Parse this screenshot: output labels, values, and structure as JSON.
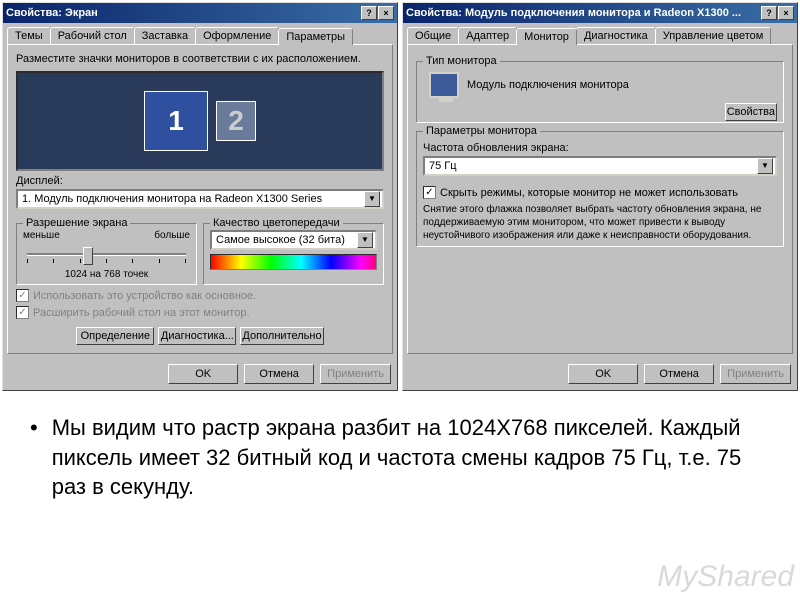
{
  "left": {
    "title": "Свойства: Экран",
    "tabs": [
      "Темы",
      "Рабочий стол",
      "Заставка",
      "Оформление",
      "Параметры"
    ],
    "active_tab": 4,
    "instruction": "Разместите значки мониторов в соответствии с их расположением.",
    "monitors": {
      "primary": "1",
      "secondary": "2"
    },
    "display_label": "Дисплей:",
    "display_value": "1. Модуль подключения монитора на Radeon X1300 Series",
    "resolution": {
      "title": "Разрешение экрана",
      "less": "меньше",
      "more": "больше",
      "value": "1024 на 768 точек"
    },
    "quality": {
      "title": "Качество цветопередачи",
      "value": "Самое высокое (32 бита)"
    },
    "check_primary": "Использовать это устройство как основное.",
    "check_extend": "Расширить рабочий стол на этот монитор.",
    "buttons": {
      "identify": "Определение",
      "troubleshoot": "Диагностика...",
      "advanced": "Дополнительно"
    }
  },
  "right": {
    "title": "Свойства: Модуль подключения монитора и Radeon X1300 ...",
    "tabs": [
      "Общие",
      "Адаптер",
      "Монитор",
      "Диагностика",
      "Управление цветом"
    ],
    "active_tab": 2,
    "group_type": "Тип монитора",
    "monitor_name": "Модуль подключения монитора",
    "properties_btn": "Свойства",
    "group_params": "Параметры монитора",
    "refresh_label": "Частота обновления экрана:",
    "refresh_value": "75 Гц",
    "hide_modes": "Скрыть режимы, которые монитор не может использовать",
    "hide_modes_info": "Снятие этого флажка позволяет выбрать частоту обновления экрана, не поддерживаемую этим монитором, что может привести к выводу неустойчивого изображения или даже к неисправности оборудования."
  },
  "dialog": {
    "ok": "OK",
    "cancel": "Отмена",
    "apply": "Применить"
  },
  "caption": "Мы видим что растр экрана разбит на 1024Х768 пикселей. Каждый пиксель имеет 32 битный код и частота смены кадров 75 Гц, т.е. 75 раз в секунду.",
  "watermark": "MyShared"
}
